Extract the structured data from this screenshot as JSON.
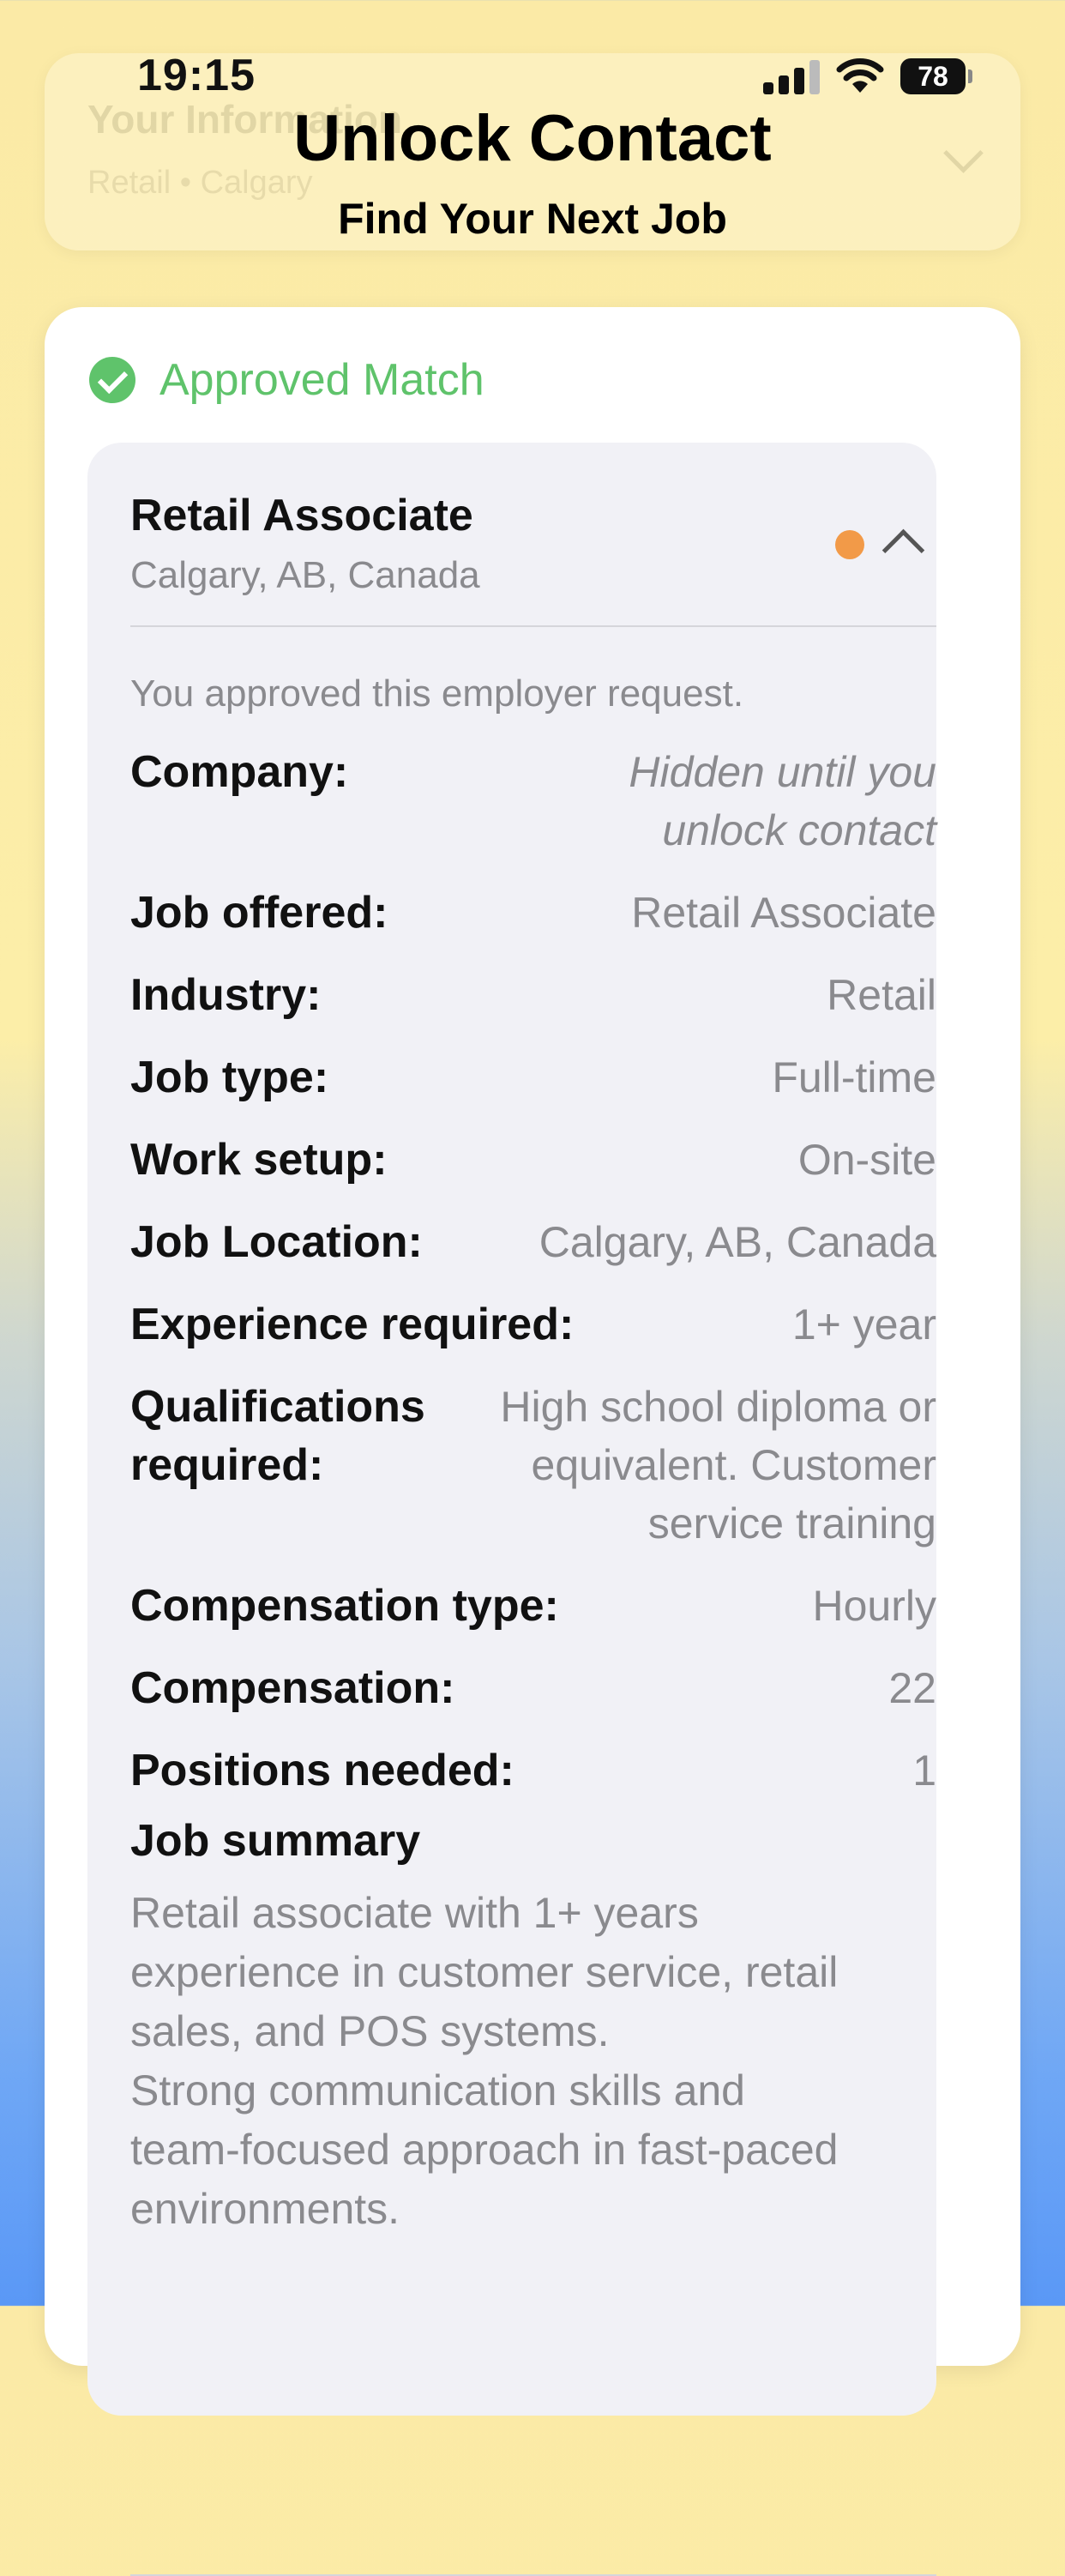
{
  "status_bar": {
    "time": "19:15",
    "battery": "78"
  },
  "background_card": {
    "title": "Your Information",
    "subtitle": "Retail • Calgary"
  },
  "nav": {
    "title": "Unlock Contact",
    "subtitle": "Find Your Next Job"
  },
  "match": {
    "status": "Approved Match",
    "job_title": "Retail Associate",
    "location": "Calgary, AB, Canada",
    "note": "You approved this employer request.",
    "details": [
      {
        "label": "Company:",
        "value": "Hidden until you\nunlock contact"
      },
      {
        "label": "Job offered:",
        "value": "Retail Associate"
      },
      {
        "label": "Industry:",
        "value": "Retail"
      },
      {
        "label": "Job type:",
        "value": "Full-time"
      },
      {
        "label": "Work setup:",
        "value": "On-site"
      },
      {
        "label": "Job Location:",
        "value": "Calgary, AB, Canada"
      },
      {
        "label": "Experience required:",
        "value": "1+ year"
      },
      {
        "label": "Qualifications\nrequired:",
        "value": "High school diploma or\nequivalent. Customer\nservice training"
      },
      {
        "label": "Compensation type:",
        "value": "Hourly"
      },
      {
        "label": "Compensation:",
        "value": "22"
      },
      {
        "label": "Positions needed:",
        "value": "1"
      }
    ],
    "summary_label": "Job summary",
    "summary_text": "Retail associate with 1+ years\nexperience in customer service, retail\nsales, and POS systems.\n Strong communication skills and\nteam-focused approach in fast-paced\nenvironments."
  },
  "colors": {
    "approved": "#5fc36b",
    "indicator": "#f29a48"
  }
}
